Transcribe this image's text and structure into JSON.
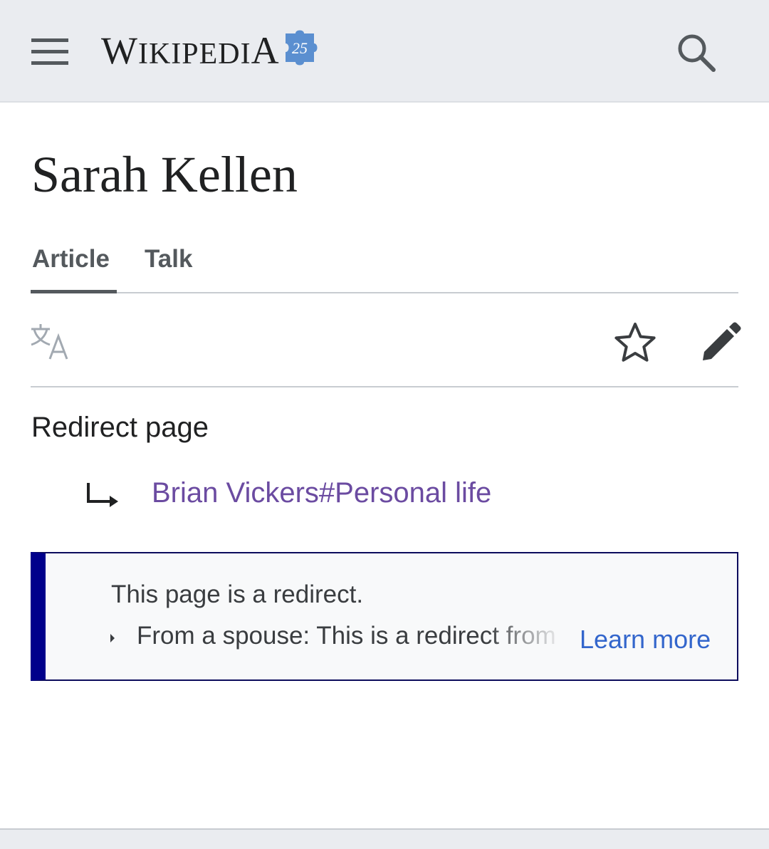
{
  "header": {
    "wordmark_first": "W",
    "wordmark_mid": "IKIPEDI",
    "wordmark_last": "A",
    "anniversary_badge": "25",
    "icons": {
      "menu": "menu-icon",
      "logo_badge": "puzzle-piece-icon",
      "search": "search-icon"
    }
  },
  "page": {
    "title": "Sarah Kellen",
    "tabs": [
      {
        "label": "Article",
        "selected": true
      },
      {
        "label": "Talk",
        "selected": false
      }
    ],
    "actions": {
      "language": "language-icon",
      "watch": "star-icon",
      "edit": "pencil-icon"
    }
  },
  "redirect": {
    "label": "Redirect page",
    "arrow_icon": "redirect-arrow-icon",
    "target": "Brian Vickers#Personal life"
  },
  "notice": {
    "title": "This page is a redirect.",
    "item": "From a spouse: This is a redirect from",
    "link": "Learn more"
  },
  "colors": {
    "header_bg": "#eaecf0",
    "text": "#202122",
    "visited_link": "#6b4ba1",
    "link": "#3366cc",
    "notice_border": "#00008b",
    "puzzle_blue": "#5b8fd0"
  }
}
